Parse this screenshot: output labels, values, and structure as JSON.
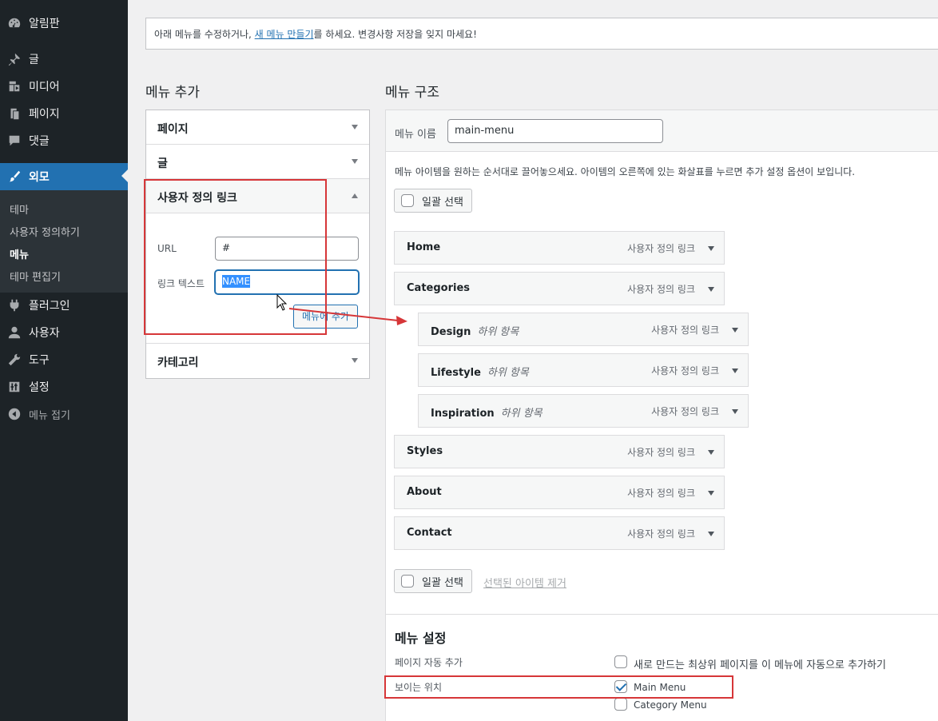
{
  "sidebar": {
    "items": [
      {
        "label": "알림판",
        "icon": "dashboard-icon"
      },
      {
        "label": "글",
        "icon": "pin-icon"
      },
      {
        "label": "미디어",
        "icon": "media-icon"
      },
      {
        "label": "페이지",
        "icon": "page-icon"
      },
      {
        "label": "댓글",
        "icon": "comment-icon"
      },
      {
        "label": "외모",
        "icon": "brush-icon"
      },
      {
        "label": "플러그인",
        "icon": "plugin-icon"
      },
      {
        "label": "사용자",
        "icon": "user-icon"
      },
      {
        "label": "도구",
        "icon": "wrench-icon"
      },
      {
        "label": "설정",
        "icon": "settings-icon"
      },
      {
        "label": "메뉴 접기",
        "icon": "collapse-icon"
      }
    ],
    "submenu": [
      "테마",
      "사용자 정의하기",
      "메뉴",
      "테마 편집기"
    ]
  },
  "notice": {
    "before": "아래 메뉴를 수정하거나, ",
    "link": "새 메뉴 만들기",
    "after": "를 하세요. 변경사항 저장을 잊지 마세요!"
  },
  "left": {
    "title": "메뉴 추가",
    "sections": [
      "페이지",
      "글",
      "사용자 정의 링크",
      "카테고리"
    ],
    "custom_link": {
      "url_label": "URL",
      "url_value": "#",
      "text_label": "링크 텍스트",
      "text_value": "NAME",
      "add_button": "메뉴에 추가"
    }
  },
  "right": {
    "title": "메뉴 구조",
    "menu_name_label": "메뉴 이름",
    "menu_name_value": "main-menu",
    "instructions": "메뉴 아이템을 원하는 순서대로 끌어놓으세요. 아이템의 오른쪽에 있는 화살표를 누르면 추가 설정 옵션이 보입니다.",
    "bulk_select": "일괄 선택",
    "remove_selected": "선택된 아이템 제거",
    "items": [
      {
        "title": "Home",
        "type": "사용자 정의 링크",
        "sub": ""
      },
      {
        "title": "Categories",
        "type": "사용자 정의 링크",
        "sub": ""
      },
      {
        "title": "Design",
        "type": "사용자 정의 링크",
        "sub": "하위 항목"
      },
      {
        "title": "Lifestyle",
        "type": "사용자 정의 링크",
        "sub": "하위 항목"
      },
      {
        "title": "Inspiration",
        "type": "사용자 정의 링크",
        "sub": "하위 항목"
      },
      {
        "title": "Styles",
        "type": "사용자 정의 링크",
        "sub": ""
      },
      {
        "title": "About",
        "type": "사용자 정의 링크",
        "sub": ""
      },
      {
        "title": "Contact",
        "type": "사용자 정의 링크",
        "sub": ""
      }
    ],
    "settings": {
      "title": "메뉴 설정",
      "auto_add_label": "페이지 자동 추가",
      "auto_add_option": "새로 만드는 최상위 페이지를 이 메뉴에 자동으로 추가하기",
      "location_label": "보이는 위치",
      "locations": [
        {
          "name": "Main Menu",
          "checked": true
        },
        {
          "name": "Category Menu",
          "checked": false
        }
      ]
    }
  },
  "colors": {
    "accent": "#2271b1",
    "sidebar_bg": "#1d2327",
    "annotation": "#d63638"
  }
}
